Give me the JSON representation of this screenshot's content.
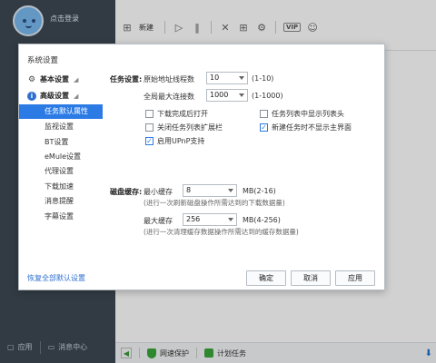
{
  "app": {
    "login_label": "点击登录",
    "toolbar": {
      "new_label": "新建",
      "vip_label": "VIP"
    },
    "bottom_left": {
      "apps_label": "应用",
      "messages_label": "消息中心"
    },
    "status_bar": {
      "net_protect_label": "网速保护",
      "scheduled_label": "计划任务"
    }
  },
  "dialog": {
    "title": "系统设置",
    "nav": {
      "basic_label": "基本设置",
      "advanced_label": "高级设置",
      "items": [
        "任务默认属性",
        "监视设置",
        "BT设置",
        "eMule设置",
        "代理设置",
        "下载加速",
        "消息提醒",
        "字幕设置"
      ],
      "active_index": 0
    },
    "task": {
      "section_label": "任务设置:",
      "orig_threads_label": "原始地址线程数",
      "orig_threads_value": "10",
      "orig_threads_range": "(1-10)",
      "max_conn_label": "全局最大连接数",
      "max_conn_value": "1000",
      "max_conn_range": "(1-1000)",
      "checkboxes": [
        {
          "label": "下载完成后打开",
          "checked": false
        },
        {
          "label": "任务列表中显示列表头",
          "checked": false
        },
        {
          "label": "关闭任务列表扩展栏",
          "checked": false
        },
        {
          "label": "新建任务时不显示主界面",
          "checked": true
        },
        {
          "label": "启用UPnP支持",
          "checked": true
        }
      ]
    },
    "cache": {
      "section_label": "磁盘缓存:",
      "min_label": "最小缓存",
      "min_value": "8",
      "min_range": "MB(2-16)",
      "min_hint": "(进行一次刷新磁盘操作所需达到的下载数据量)",
      "max_label": "最大缓存",
      "max_value": "256",
      "max_range": "MB(4-256)",
      "max_hint": "(进行一次清理缓存数据操作所需达到的缓存数据量)"
    },
    "footer": {
      "restore_label": "恢复全部默认设置",
      "ok_label": "确定",
      "cancel_label": "取消",
      "apply_label": "应用"
    }
  },
  "colors": {
    "accent": "#2c7be5",
    "sidebar_bg": "#3d4853",
    "link": "#2c6fd1",
    "status_green": "#3aa53a"
  }
}
